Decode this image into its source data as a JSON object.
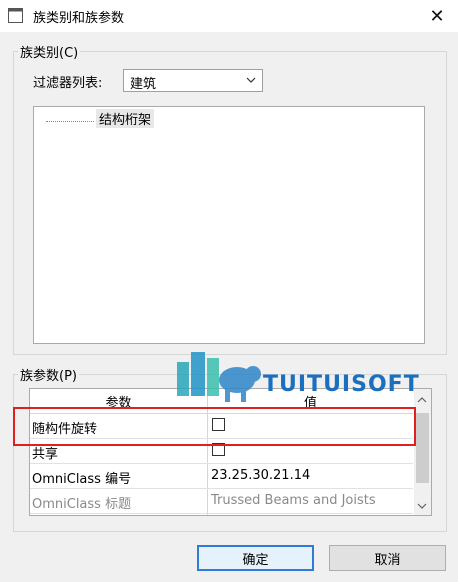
{
  "window": {
    "title": "族类别和族参数",
    "close_glyph": "✕"
  },
  "family_category": {
    "group_label": "族类别(C)",
    "filter_label": "过滤器列表:",
    "filter_value": "建筑",
    "tree_items": [
      "结构桁架"
    ]
  },
  "family_parameters": {
    "group_label": "族参数(P)",
    "columns": [
      "参数",
      "值"
    ],
    "rows": [
      {
        "name": "随构件旋转",
        "value": "",
        "checkbox": true,
        "checked": false
      },
      {
        "name": "共享",
        "value": "",
        "checkbox": true,
        "checked": false
      },
      {
        "name": "OmniClass 编号",
        "value": "23.25.30.21.14",
        "checkbox": false
      },
      {
        "name": "OmniClass 标题",
        "value": "Trussed Beams and Joists",
        "checkbox": false,
        "disabled": true
      }
    ]
  },
  "buttons": {
    "ok": "确定",
    "cancel": "取消"
  },
  "watermark": {
    "text": "TUITUISOFT"
  },
  "colors": {
    "highlight": "#e02020",
    "primary_border": "#2f7bd6",
    "watermark": "#1a6fbf"
  }
}
